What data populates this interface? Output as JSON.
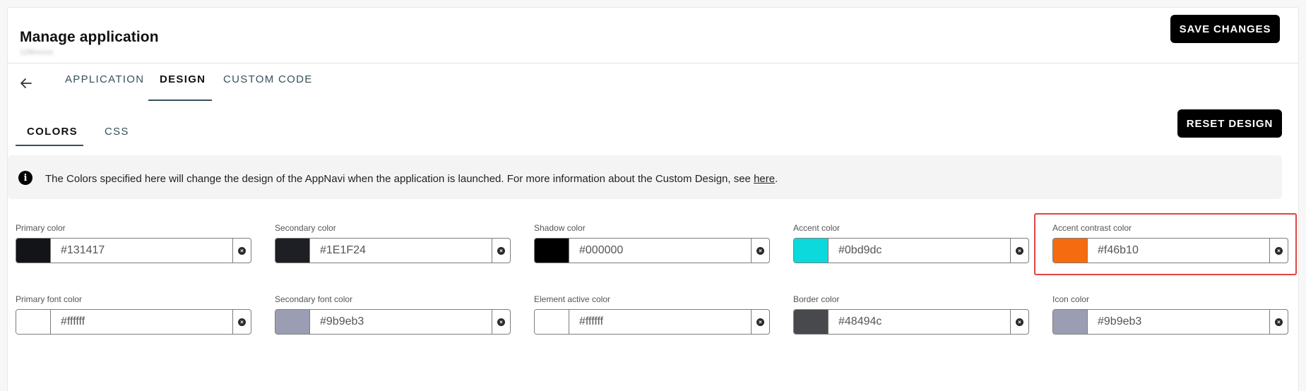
{
  "header": {
    "title": "Manage application",
    "subtitle": "1286xxxxx",
    "save_label": "SAVE CHANGES"
  },
  "tabs": [
    {
      "label": "APPLICATION"
    },
    {
      "label": "DESIGN"
    },
    {
      "label": "CUSTOM CODE"
    }
  ],
  "subtabs": [
    {
      "label": "COLORS"
    },
    {
      "label": "CSS"
    }
  ],
  "reset_label": "RESET DESIGN",
  "info": {
    "text": "The Colors specified here will change the design of the AppNavi when the application is launched. For more information about the Custom Design, see ",
    "link": "here",
    "suffix": "."
  },
  "colors": [
    {
      "label": "Primary color",
      "value": "#131417"
    },
    {
      "label": "Secondary color",
      "value": "#1E1F24"
    },
    {
      "label": "Shadow color",
      "value": "#000000"
    },
    {
      "label": "Accent color",
      "value": "#0bd9dc"
    },
    {
      "label": "Accent contrast color",
      "value": "#f46b10"
    },
    {
      "label": "Primary font color",
      "value": "#ffffff"
    },
    {
      "label": "Secondary font color",
      "value": "#9b9eb3"
    },
    {
      "label": "Element active color",
      "value": "#ffffff"
    },
    {
      "label": "Border color",
      "value": "#48494c"
    },
    {
      "label": "Icon color",
      "value": "#9b9eb3"
    }
  ]
}
